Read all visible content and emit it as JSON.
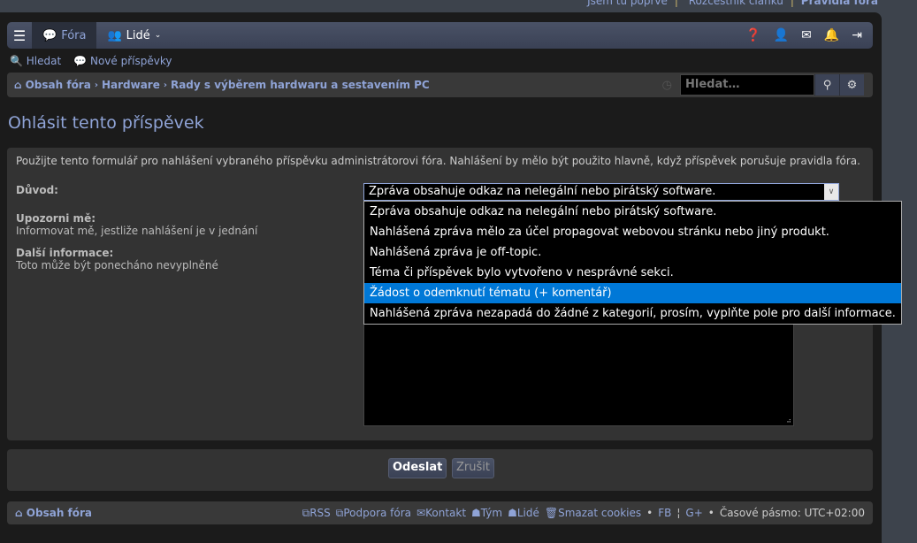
{
  "top_links": [
    "Jsem tu poprvé",
    "Rozcestník článků",
    "Pravidla fóra"
  ],
  "nav": {
    "forums": "Fóra",
    "people": "Lidé"
  },
  "sub": {
    "search": "Hledat",
    "new_posts": "Nové příspěvky"
  },
  "breadcrumb": [
    "Obsah fóra",
    "Hardware",
    "Rady s výběrem hardwaru a sestavením PC"
  ],
  "search": {
    "placeholder": "Hledat…"
  },
  "page_title": "Ohlásit tento příspěvek",
  "form": {
    "intro": "Použijte tento formulář pro nahlášení vybraného příspěvku administrátorovi fóra. Nahlášení by mělo být použito hlavně, když příspěvek porušuje pravidla fóra.",
    "reason_label": "Důvod:",
    "notify_label": "Upozorni mě:",
    "notify_desc": "Informovat mě, jestliže nahlášení je v jednání",
    "info_label": "Další informace:",
    "info_desc": "Toto může být ponecháno nevyplněné",
    "selected": "Zpráva obsahuje odkaz na nelegální nebo pirátský software.",
    "options": [
      "Zpráva obsahuje odkaz na nelegální nebo pirátský software.",
      "Nahlášená zpráva mělo za účel propagovat webovou stránku nebo jiný produkt.",
      "Nahlášená zpráva je off-topic.",
      "Téma či příspěvek bylo vytvořeno v nesprávné sekci.",
      "Žádost o odemknutí tématu (+ komentář)",
      "Nahlášená zpráva nezapadá do žádné z kategorií, prosím, vyplňte pole pro další informace."
    ],
    "submit": "Odeslat",
    "cancel": "Zrušit"
  },
  "footer": {
    "home": "Obsah fóra",
    "rss": "RSS",
    "support": "Podpora fóra",
    "contact": "Kontakt",
    "team": "Tým",
    "people": "Lidé",
    "cookies": "Smazat cookies",
    "fb": "FB",
    "gplus": "G+",
    "timezone": "Časové pásmo: UTC+02:00"
  }
}
